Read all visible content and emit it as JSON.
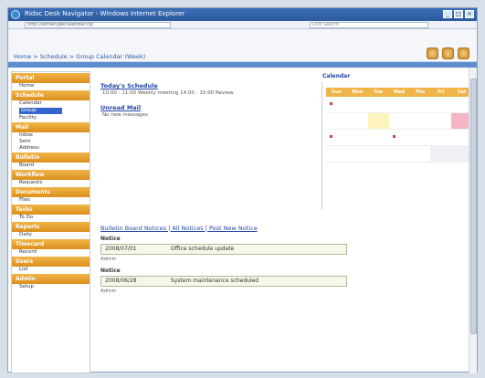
{
  "window": {
    "title": "Ridoc Desk Navigator - Windows Internet Explorer",
    "address": "http://server/gw/calendar.cgi",
    "search_placeholder": "Live Search"
  },
  "header": {
    "breadcrumb": "Home > Schedule > Group Calendar (Week)",
    "tool_icons": [
      "help-icon",
      "settings-icon",
      "logout-icon"
    ]
  },
  "sidebar": {
    "sections": [
      {
        "title": "Portal",
        "items": [
          "Home"
        ]
      },
      {
        "title": "Schedule",
        "items": [
          "Calendar",
          "Group",
          "Facility"
        ]
      },
      {
        "title": "Mail",
        "items": [
          "Inbox",
          "Sent",
          "Address"
        ]
      },
      {
        "title": "Bulletin",
        "items": [
          "Board"
        ]
      },
      {
        "title": "Workflow",
        "items": [
          "Requests"
        ]
      },
      {
        "title": "Documents",
        "items": [
          "Files"
        ]
      },
      {
        "title": "Tasks",
        "items": [
          "To Do"
        ]
      },
      {
        "title": "Reports",
        "items": [
          "Daily"
        ]
      },
      {
        "title": "Timecard",
        "items": [
          "Record"
        ]
      },
      {
        "title": "Users",
        "items": [
          "List"
        ]
      },
      {
        "title": "Admin",
        "items": [
          "Setup"
        ]
      }
    ],
    "selected_item": "Group"
  },
  "main": {
    "todo_title": "Today's Schedule",
    "todo_text": "10:00 - 11:00  Weekly meeting   14:00 - 15:00  Review",
    "unread_title": "Unread Mail",
    "unread_text": "No new messages",
    "calendar_title": "Calendar",
    "calendar_headers": [
      "Sun",
      "Mon",
      "Tue",
      "Wed",
      "Thu",
      "Fri",
      "Sat"
    ],
    "news_title": "Bulletin Board Notices  |  All Notices  |  Post New Notice",
    "news": [
      {
        "label": "Notice",
        "date": "2008/07/01",
        "text": "Office schedule update",
        "meta": "Admin"
      },
      {
        "label": "Notice",
        "date": "2008/06/28",
        "text": "System maintenance scheduled",
        "meta": "Admin"
      }
    ]
  }
}
